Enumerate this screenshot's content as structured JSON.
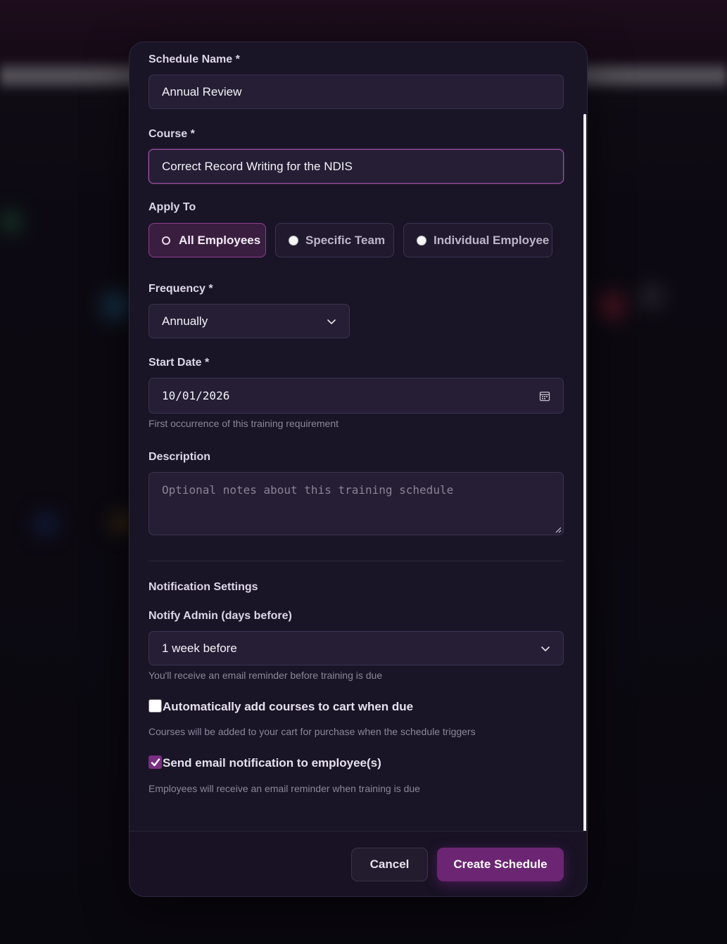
{
  "form": {
    "schedule_name": {
      "label": "Schedule Name *",
      "value": "Annual Review"
    },
    "course": {
      "label": "Course *",
      "value": "Correct Record Writing for the NDIS"
    },
    "apply_to": {
      "label": "Apply To",
      "options": [
        "All Employees",
        "Specific Team",
        "Individual Employee"
      ],
      "selected": "All Employees"
    },
    "frequency": {
      "label": "Frequency *",
      "value": "Annually"
    },
    "start_date": {
      "label": "Start Date *",
      "value": "10/01/2026",
      "help": "First occurrence of this training requirement"
    },
    "description": {
      "label": "Description",
      "placeholder": "Optional notes about this training schedule"
    }
  },
  "notifications": {
    "title": "Notification Settings",
    "notify_admin": {
      "label": "Notify Admin (days before)",
      "value": "1 week before",
      "help": "You'll receive an email reminder before training is due"
    },
    "auto_cart": {
      "label": "Automatically add courses to cart when due",
      "checked": false,
      "help": "Courses will be added to your cart for purchase when the schedule triggers"
    },
    "email_employee": {
      "label": "Send email notification to employee(s)",
      "checked": true,
      "help": "Employees will receive an email reminder when training is due"
    }
  },
  "footer": {
    "cancel_label": "Cancel",
    "submit_label": "Create Schedule"
  },
  "colors": {
    "accent": "#6b2572",
    "modal_bg": "#1a1427",
    "input_bg": "#251e35"
  },
  "icons": {
    "calendar": "calendar-icon",
    "chevron": "chevron-down-icon",
    "check": "check-icon"
  }
}
